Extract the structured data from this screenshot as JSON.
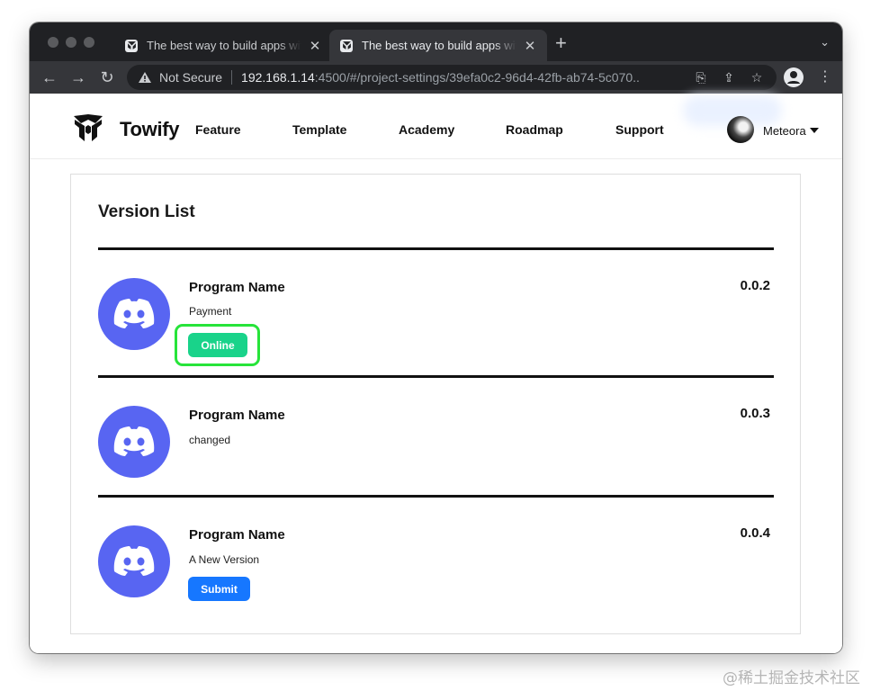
{
  "browser": {
    "tabs": [
      {
        "title": "The best way to build apps with Towify",
        "active": false
      },
      {
        "title": "The best way to build apps with Towify",
        "active": true
      }
    ],
    "new_tab_label": "+",
    "address": {
      "security_label": "Not Secure",
      "host": "192.168.1.14",
      "path": ":4500/#/project-settings/39efa0c2-96d4-42fb-ab74-5c070..."
    }
  },
  "header": {
    "brand": "Towify",
    "nav": [
      "Feature",
      "Template",
      "Academy",
      "Roadmap",
      "Support"
    ],
    "user": {
      "name": "Meteora"
    }
  },
  "version_list": {
    "title": "Version List",
    "items": [
      {
        "name": "Program Name",
        "desc": "Payment",
        "version": "0.0.2",
        "button": "Online"
      },
      {
        "name": "Program Name",
        "desc": "changed",
        "version": "0.0.3"
      },
      {
        "name": "Program Name",
        "desc": "A New Version",
        "version": "0.0.4",
        "button": "Submit"
      }
    ]
  },
  "colors": {
    "discord": "#5865f2",
    "online": "#19d38a",
    "submit": "#1677ff",
    "highlight": "#27e43a"
  },
  "watermark": "@稀土掘金技术社区"
}
